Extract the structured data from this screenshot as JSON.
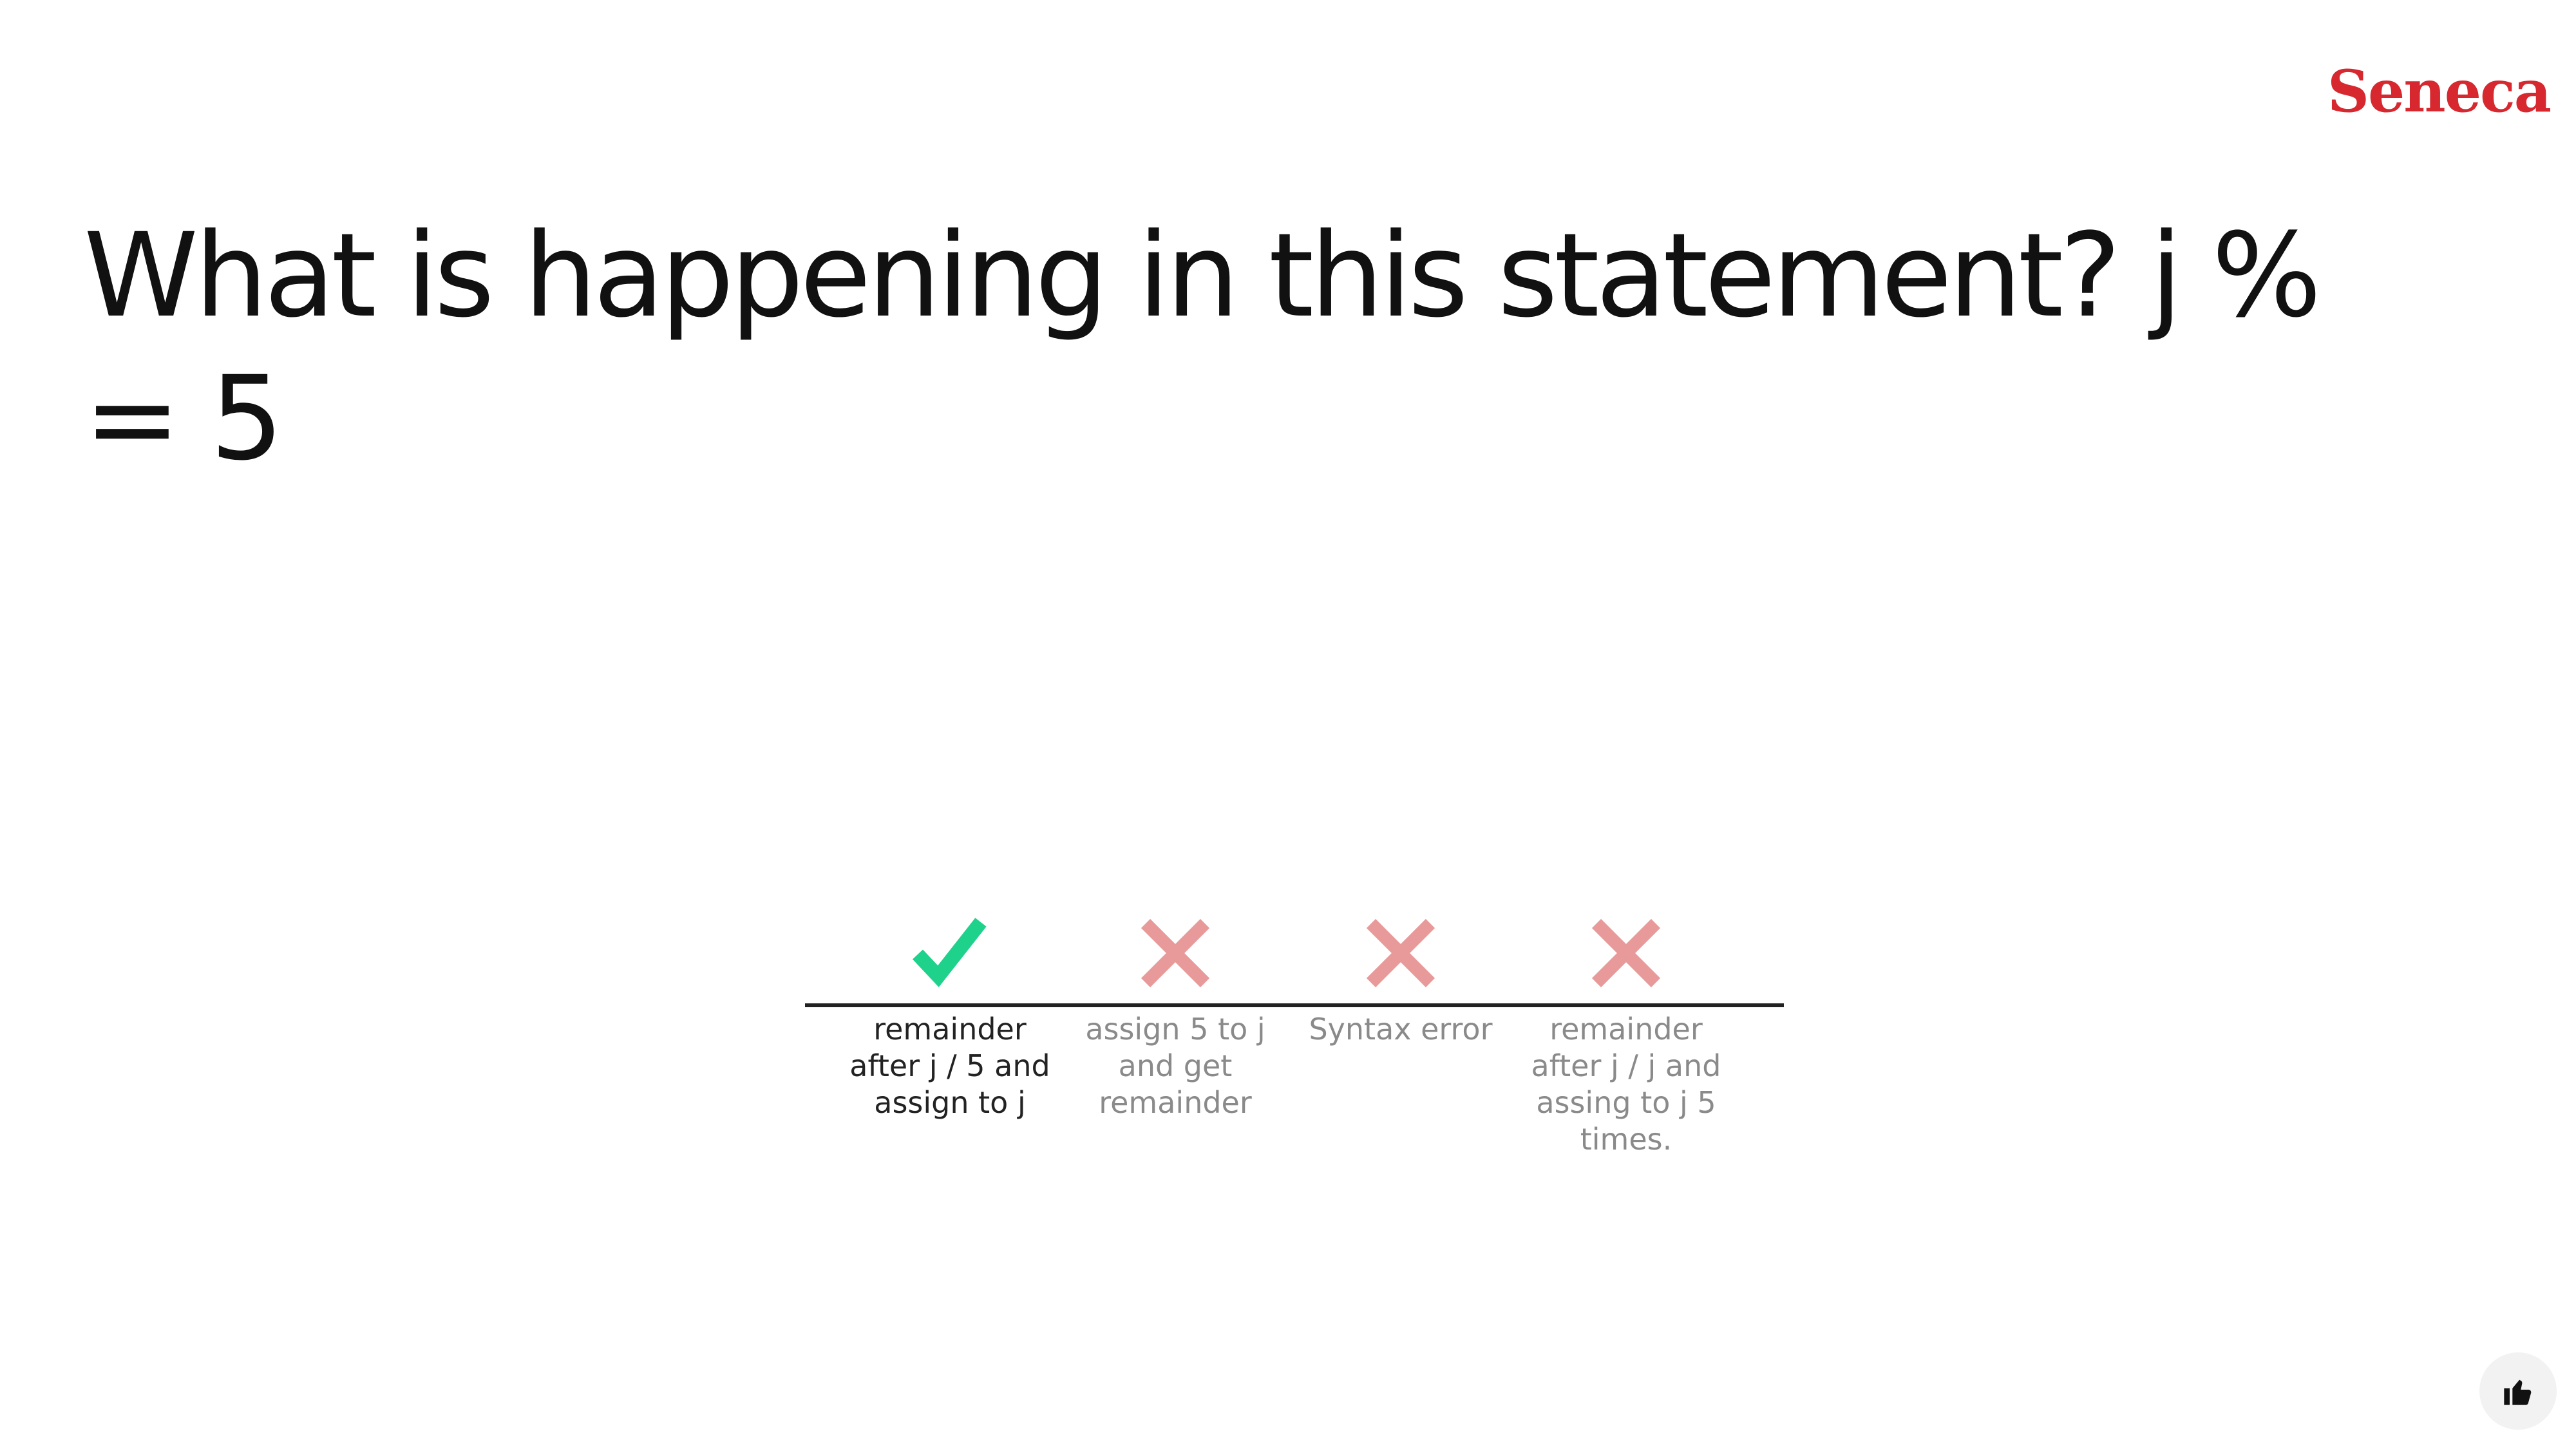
{
  "brand": {
    "logo_text": "Seneca",
    "color": "#d7282f"
  },
  "question": {
    "text": "What is happening in this statement? j % = 5"
  },
  "options": [
    {
      "label": "remainder after j / 5 and assign to j",
      "status": "correct",
      "icon": "check-icon",
      "color": "#1ed28b"
    },
    {
      "label": "assign 5 to j and get remainder",
      "status": "incorrect",
      "icon": "cross-icon",
      "color": "#e89a9a"
    },
    {
      "label": "Syntax error",
      "status": "incorrect",
      "icon": "cross-icon",
      "color": "#e89a9a"
    },
    {
      "label": "remainder after j / j and assing to j 5 times.",
      "status": "incorrect",
      "icon": "cross-icon",
      "color": "#e89a9a"
    }
  ],
  "feedback": {
    "icon": "thumbs-up-icon"
  }
}
